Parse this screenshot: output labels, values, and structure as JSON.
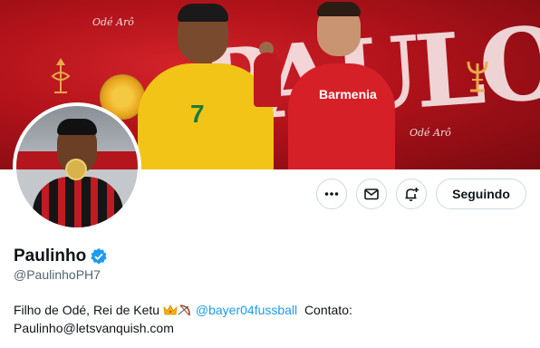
{
  "banner": {
    "script_text_left": "Odé Arô",
    "script_text_right": "Odé Arô",
    "big_text": "PAULO",
    "player2_sponsor": "Barmenia",
    "player1_number": "7"
  },
  "actions": {
    "more_icon": "more-dots-icon",
    "message_icon": "mail-icon",
    "notify_icon": "bell-plus-icon",
    "follow_label": "Seguindo"
  },
  "profile": {
    "name": "Paulinho",
    "verified_icon": "verified-badge-icon",
    "handle": "@PaulinhoPH7",
    "bio_text_1": "Filho de Odé, Rei de Ketu ",
    "bio_mention": "@bayer04fussball",
    "bio_text_2": "  Contato:",
    "bio_email": "Paulinho@letsvanquish.com"
  },
  "colors": {
    "accent": "#1d9bf0",
    "text": "#0f1419",
    "muted": "#536471",
    "banner_red": "#c01820"
  }
}
